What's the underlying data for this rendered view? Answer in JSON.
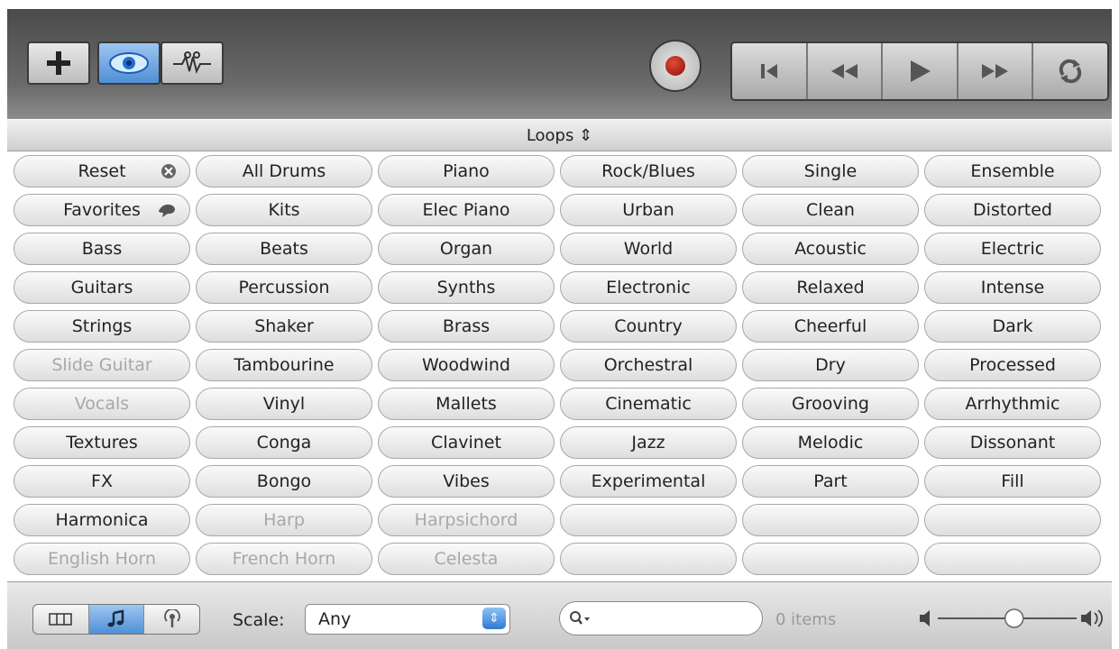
{
  "toolbar": {
    "add_icon": "plus-icon",
    "view_icon": "eye-icon",
    "editor_icon": "scissors-icon",
    "record_icon": "record-icon",
    "transport_icons": [
      "skip-to-start-icon",
      "rewind-icon",
      "play-icon",
      "fast-forward-icon",
      "cycle-icon"
    ]
  },
  "loops_header": {
    "label": "Loops ⇕"
  },
  "keywords": [
    [
      {
        "label": "Reset",
        "dim": false,
        "icon": "clear-icon"
      },
      {
        "label": "All Drums",
        "dim": false
      },
      {
        "label": "Piano",
        "dim": false
      },
      {
        "label": "Rock/Blues",
        "dim": false
      },
      {
        "label": "Single",
        "dim": false
      },
      {
        "label": "Ensemble",
        "dim": false
      }
    ],
    [
      {
        "label": "Favorites",
        "dim": false,
        "icon": "favorites-icon"
      },
      {
        "label": "Kits",
        "dim": false
      },
      {
        "label": "Elec Piano",
        "dim": false
      },
      {
        "label": "Urban",
        "dim": false
      },
      {
        "label": "Clean",
        "dim": false
      },
      {
        "label": "Distorted",
        "dim": false
      }
    ],
    [
      {
        "label": "Bass",
        "dim": false
      },
      {
        "label": "Beats",
        "dim": false
      },
      {
        "label": "Organ",
        "dim": false
      },
      {
        "label": "World",
        "dim": false
      },
      {
        "label": "Acoustic",
        "dim": false
      },
      {
        "label": "Electric",
        "dim": false
      }
    ],
    [
      {
        "label": "Guitars",
        "dim": false
      },
      {
        "label": "Percussion",
        "dim": false
      },
      {
        "label": "Synths",
        "dim": false
      },
      {
        "label": "Electronic",
        "dim": false
      },
      {
        "label": "Relaxed",
        "dim": false
      },
      {
        "label": "Intense",
        "dim": false
      }
    ],
    [
      {
        "label": "Strings",
        "dim": false
      },
      {
        "label": "Shaker",
        "dim": false
      },
      {
        "label": "Brass",
        "dim": false
      },
      {
        "label": "Country",
        "dim": false
      },
      {
        "label": "Cheerful",
        "dim": false
      },
      {
        "label": "Dark",
        "dim": false
      }
    ],
    [
      {
        "label": "Slide Guitar",
        "dim": true
      },
      {
        "label": "Tambourine",
        "dim": false
      },
      {
        "label": "Woodwind",
        "dim": false
      },
      {
        "label": "Orchestral",
        "dim": false
      },
      {
        "label": "Dry",
        "dim": false
      },
      {
        "label": "Processed",
        "dim": false
      }
    ],
    [
      {
        "label": "Vocals",
        "dim": true
      },
      {
        "label": "Vinyl",
        "dim": false
      },
      {
        "label": "Mallets",
        "dim": false
      },
      {
        "label": "Cinematic",
        "dim": false
      },
      {
        "label": "Grooving",
        "dim": false
      },
      {
        "label": "Arrhythmic",
        "dim": false
      }
    ],
    [
      {
        "label": "Textures",
        "dim": false
      },
      {
        "label": "Conga",
        "dim": false
      },
      {
        "label": "Clavinet",
        "dim": false
      },
      {
        "label": "Jazz",
        "dim": false
      },
      {
        "label": "Melodic",
        "dim": false
      },
      {
        "label": "Dissonant",
        "dim": false
      }
    ],
    [
      {
        "label": "FX",
        "dim": false
      },
      {
        "label": "Bongo",
        "dim": false
      },
      {
        "label": "Vibes",
        "dim": false
      },
      {
        "label": "Experimental",
        "dim": false
      },
      {
        "label": "Part",
        "dim": false
      },
      {
        "label": "Fill",
        "dim": false
      }
    ],
    [
      {
        "label": "Harmonica",
        "dim": false
      },
      {
        "label": "Harp",
        "dim": true
      },
      {
        "label": "Harpsichord",
        "dim": true
      },
      {
        "label": "",
        "dim": false
      },
      {
        "label": "",
        "dim": false
      },
      {
        "label": "",
        "dim": false
      }
    ],
    [
      {
        "label": "English Horn",
        "dim": true
      },
      {
        "label": "French Horn",
        "dim": true
      },
      {
        "label": "Celesta",
        "dim": true
      },
      {
        "label": "",
        "dim": false
      },
      {
        "label": "",
        "dim": false
      },
      {
        "label": "",
        "dim": false
      }
    ]
  ],
  "bottom": {
    "view_modes": [
      {
        "icon": "column-view-icon",
        "active": false
      },
      {
        "icon": "music-note-icon",
        "active": true
      },
      {
        "icon": "podcast-icon",
        "active": false
      }
    ],
    "scale_label": "Scale:",
    "scale_value": "Any",
    "search_placeholder": "",
    "items_count": "0 items",
    "volume_level": 0.55
  }
}
